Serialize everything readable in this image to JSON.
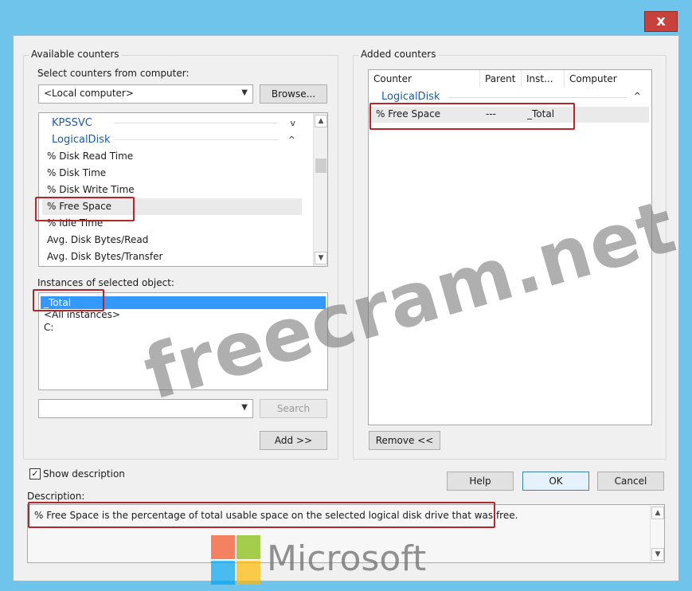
{
  "window": {
    "close_glyph": "x"
  },
  "available": {
    "group_label": "Available counters",
    "select_label": "Select counters from computer:",
    "computer_value": "<Local computer>",
    "browse_label": "Browse...",
    "objects": [
      {
        "label": "KPSSVC",
        "type": "header",
        "chevron": "v"
      },
      {
        "label": "LogicalDisk",
        "type": "header",
        "chevron": "^"
      },
      {
        "label": "% Disk Read Time",
        "type": "item"
      },
      {
        "label": "% Disk Time",
        "type": "item"
      },
      {
        "label": "% Disk Write Time",
        "type": "item"
      },
      {
        "label": "% Free Space",
        "type": "item"
      },
      {
        "label": "% Idle Time",
        "type": "item"
      },
      {
        "label": "Avg. Disk Bytes/Read",
        "type": "item"
      },
      {
        "label": "Avg. Disk Bytes/Transfer",
        "type": "item"
      }
    ],
    "instances_label": "Instances of selected object:",
    "instances": [
      "_Total",
      "<All instances>",
      "C:"
    ],
    "search_label": "Search",
    "add_label": "Add >>"
  },
  "added": {
    "group_label": "Added counters",
    "columns": [
      "Counter",
      "Parent",
      "Inst...",
      "Computer"
    ],
    "group_row": "LogicalDisk",
    "group_chevron": "^",
    "rows": [
      {
        "counter": "% Free Space",
        "parent": "---",
        "instance": "_Total",
        "computer": ""
      }
    ],
    "remove_label": "Remove <<"
  },
  "footer": {
    "show_description_label": "Show description",
    "show_description_checked": true,
    "help_label": "Help",
    "ok_label": "OK",
    "cancel_label": "Cancel",
    "description_label": "Description:",
    "description_text": "% Free Space is the percentage of total usable space on the selected logical disk drive that was free."
  },
  "watermarks": {
    "site": "freecram.net",
    "brand": "Microsoft"
  },
  "colors": {
    "highlight_box": "#b3262b",
    "selection": "#3399ff",
    "title_bar": "#6ec4ea",
    "close_button": "#c7423c"
  }
}
